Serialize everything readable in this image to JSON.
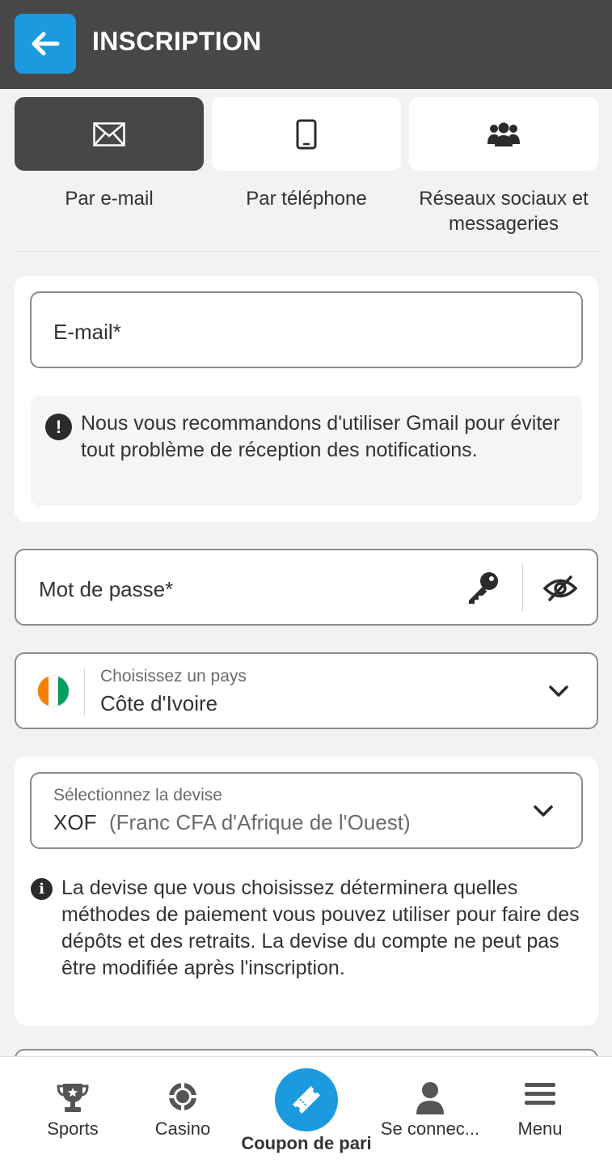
{
  "header": {
    "title": "INSCRIPTION"
  },
  "registration_methods": [
    {
      "label": "Par e-mail",
      "icon": "envelope-icon",
      "active": true
    },
    {
      "label": "Par téléphone",
      "icon": "mobile-phone-icon",
      "active": false
    },
    {
      "label": "Réseaux sociaux et messageries",
      "icon": "users-group-icon",
      "active": false
    }
  ],
  "email_card": {
    "email_placeholder": "E-mail*",
    "notice": "Nous vous recommandons d'utiliser Gmail pour éviter tout problème de réception des notifications."
  },
  "password": {
    "placeholder": "Mot de passe*"
  },
  "country": {
    "label": "Choisissez un pays",
    "value": "Côte d'Ivoire"
  },
  "currency": {
    "label": "Sélectionnez la devise",
    "code": "XOF",
    "name": "(Franc CFA d'Afrique de l'Ouest)",
    "info": "La devise que vous choisissez déterminera quelles méthodes de paiement vous pouvez utiliser pour faire des dépôts et des retraits. La devise du compte ne peut pas être modifiée après l'inscription."
  },
  "bottom_nav": {
    "sports": "Sports",
    "casino": "Casino",
    "coupon": "Coupon de pari",
    "login": "Se connec...",
    "menu": "Menu"
  },
  "colors": {
    "header": "#474747",
    "accent": "#1b9ae0",
    "background": "#f2f2f2"
  }
}
